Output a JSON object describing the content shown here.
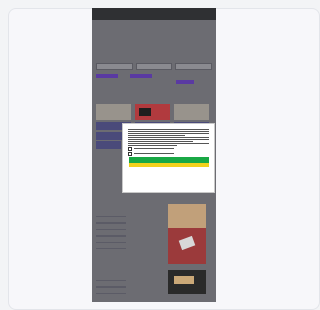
{
  "site": {
    "logo": "",
    "nav": [
      "",
      "",
      "",
      ""
    ]
  },
  "hero": {
    "headline": ""
  },
  "sections": {
    "sidebar_title": "",
    "bottom_title": ""
  },
  "consent": {
    "title": "",
    "subheading": "",
    "accept_label": "",
    "secondary_label": ""
  },
  "colors": {
    "accent_green": "#19a845",
    "accent_yellow": "#f2d11c",
    "accent_purple": "#5a3aa2"
  }
}
